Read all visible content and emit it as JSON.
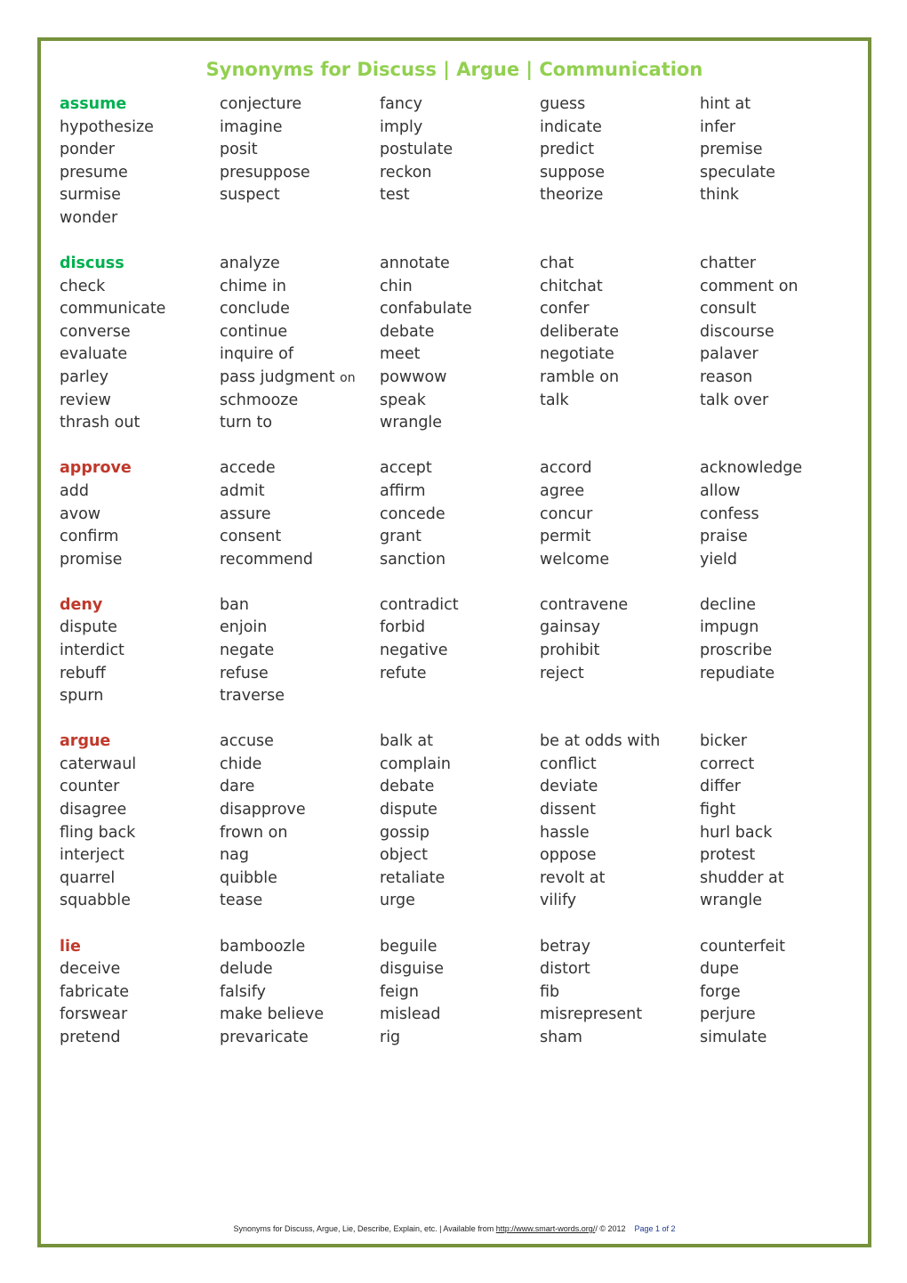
{
  "title": "Synonyms for Discuss | Argue | Communication",
  "colors": {
    "border": "#76923c",
    "title": "#92d050",
    "green_head": "#00b050",
    "red_head": "#c0392b",
    "text": "#333333"
  },
  "sections": [
    {
      "head": "assume",
      "head_color": "green",
      "words": [
        "conjecture",
        "fancy",
        "guess",
        "hint at",
        "hypothesize",
        "imagine",
        "imply",
        "indicate",
        "infer",
        "ponder",
        "posit",
        "postulate",
        "predict",
        "premise",
        "presume",
        "presuppose",
        "reckon",
        "suppose",
        "speculate",
        "surmise",
        "suspect",
        "test",
        "theorize",
        "think",
        "wonder"
      ]
    },
    {
      "head": "discuss",
      "head_color": "green",
      "words": [
        "analyze",
        "annotate",
        "chat",
        "chatter",
        "check",
        "chime in",
        "chin",
        "chitchat",
        "comment on",
        "communicate",
        "conclude",
        "confabulate",
        "confer",
        "consult",
        "converse",
        "continue",
        "debate",
        "deliberate",
        "discourse",
        "evaluate",
        "inquire of",
        "meet",
        "negotiate",
        "palaver",
        "parley",
        "pass judgment on",
        "powwow",
        "ramble on",
        "reason",
        "review",
        "schmooze",
        "speak",
        "talk",
        "talk over",
        "thrash out",
        "turn to",
        "wrangle"
      ]
    },
    {
      "head": "approve",
      "head_color": "red",
      "words": [
        "accede",
        "accept",
        "accord",
        "acknowledge",
        "add",
        "admit",
        "affirm",
        "agree",
        "allow",
        "avow",
        "assure",
        "concede",
        "concur",
        "confess",
        "confirm",
        "consent",
        "grant",
        "permit",
        "praise",
        "promise",
        "recommend",
        "sanction",
        "welcome",
        "yield"
      ]
    },
    {
      "head": "deny",
      "head_color": "red",
      "words": [
        "ban",
        "contradict",
        "contravene",
        "decline",
        "dispute",
        "enjoin",
        "forbid",
        "gainsay",
        "impugn",
        "interdict",
        "negate",
        "negative",
        "prohibit",
        "proscribe",
        "rebuff",
        "refuse",
        "refute",
        "reject",
        "repudiate",
        "spurn",
        "traverse"
      ]
    },
    {
      "head": "argue",
      "head_color": "red",
      "words": [
        "accuse",
        "balk at",
        "be at odds with",
        "bicker",
        "caterwaul",
        "chide",
        "complain",
        "conflict",
        "correct",
        "counter",
        "dare",
        "debate",
        "deviate",
        "differ",
        "disagree",
        "disapprove",
        "dispute",
        "dissent",
        "fight",
        "fling back",
        "frown on",
        "gossip",
        "hassle",
        "hurl back",
        "interject",
        "nag",
        "object",
        "oppose",
        "protest",
        "quarrel",
        "quibble",
        "retaliate",
        "revolt at",
        "shudder at",
        "squabble",
        "tease",
        "urge",
        "vilify",
        "wrangle"
      ]
    },
    {
      "head": "lie",
      "head_color": "red",
      "words": [
        "bamboozle",
        "beguile",
        "betray",
        "counterfeit",
        "deceive",
        "delude",
        "disguise",
        "distort",
        "dupe",
        "fabricate",
        "falsify",
        "feign",
        "fib",
        "forge",
        "forswear",
        "make believe",
        "mislead",
        "misrepresent",
        "perjure",
        "pretend",
        "prevaricate",
        "rig",
        "sham",
        "simulate"
      ]
    }
  ],
  "footer": {
    "text": "Synonyms for Discuss, Argue, Lie, Describe, Explain, etc.   |   Available from ",
    "link": "http://www.smart-words.org/",
    "copyright": "/  © 2012",
    "page": "Page 1 of 2"
  }
}
